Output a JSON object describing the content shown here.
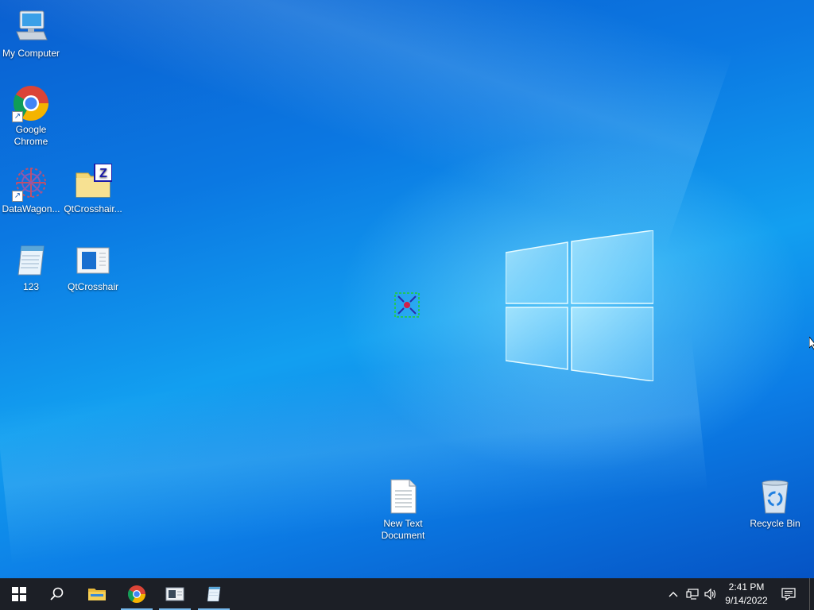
{
  "desktop": {
    "icons": [
      {
        "id": "my-computer",
        "label": "My Computer"
      },
      {
        "id": "google-chrome",
        "label": "Google Chrome"
      },
      {
        "id": "datawagon",
        "label": "DataWagon..."
      },
      {
        "id": "qtcrosshair-zip",
        "label": "QtCrosshair..."
      },
      {
        "id": "notepad-123",
        "label": "123"
      },
      {
        "id": "qtcrosshair-app",
        "label": "QtCrosshair"
      },
      {
        "id": "new-text-document",
        "label": "New Text Document"
      },
      {
        "id": "recycle-bin",
        "label": "Recycle Bin"
      }
    ]
  },
  "taskbar": {
    "buttons": [
      {
        "name": "start-button",
        "icon": "windows-logo-icon"
      },
      {
        "name": "search-button",
        "icon": "search-icon"
      },
      {
        "name": "file-explorer-button",
        "icon": "folder-icon"
      },
      {
        "name": "chrome-button",
        "icon": "chrome-icon"
      },
      {
        "name": "qtcrosshair-button",
        "icon": "app-window-icon"
      },
      {
        "name": "notepad-button",
        "icon": "notepad-icon"
      }
    ],
    "clock": {
      "time": "2:41 PM",
      "date": "9/14/2022"
    }
  },
  "colors": {
    "taskbar_bg": "#1c1f26",
    "running_indicator": "#76b9ed",
    "desktop_blue": "#0b78e2"
  }
}
